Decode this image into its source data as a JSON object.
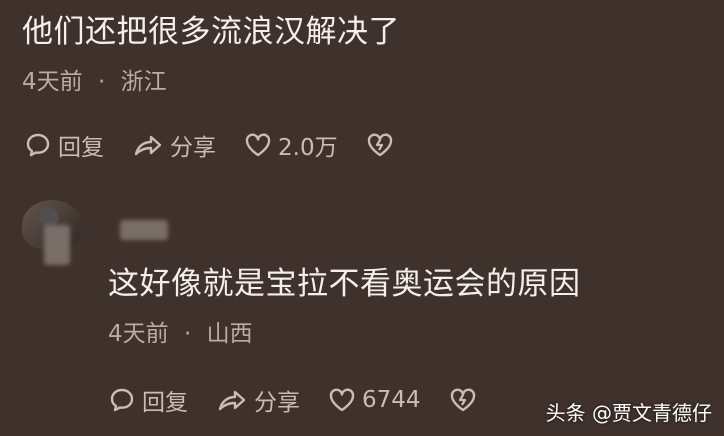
{
  "comments": [
    {
      "text": "他们还把很多流浪汉解决了",
      "time": "4天前",
      "separator": "·",
      "location": "浙江",
      "reply_label": "回复",
      "share_label": "分享",
      "like_count": "2.0万"
    },
    {
      "text": "这好像就是宝拉不看奥运会的原因",
      "time": "4天前",
      "separator": "·",
      "location": "山西",
      "reply_label": "回复",
      "share_label": "分享",
      "like_count": "6744"
    }
  ],
  "watermark": "头条 @贾文青德仔",
  "colors": {
    "background": "#3f312b",
    "text": "#f3efed",
    "meta": "#b8aca6"
  },
  "icons": [
    "reply-icon",
    "share-icon",
    "like-icon",
    "dislike-icon"
  ]
}
